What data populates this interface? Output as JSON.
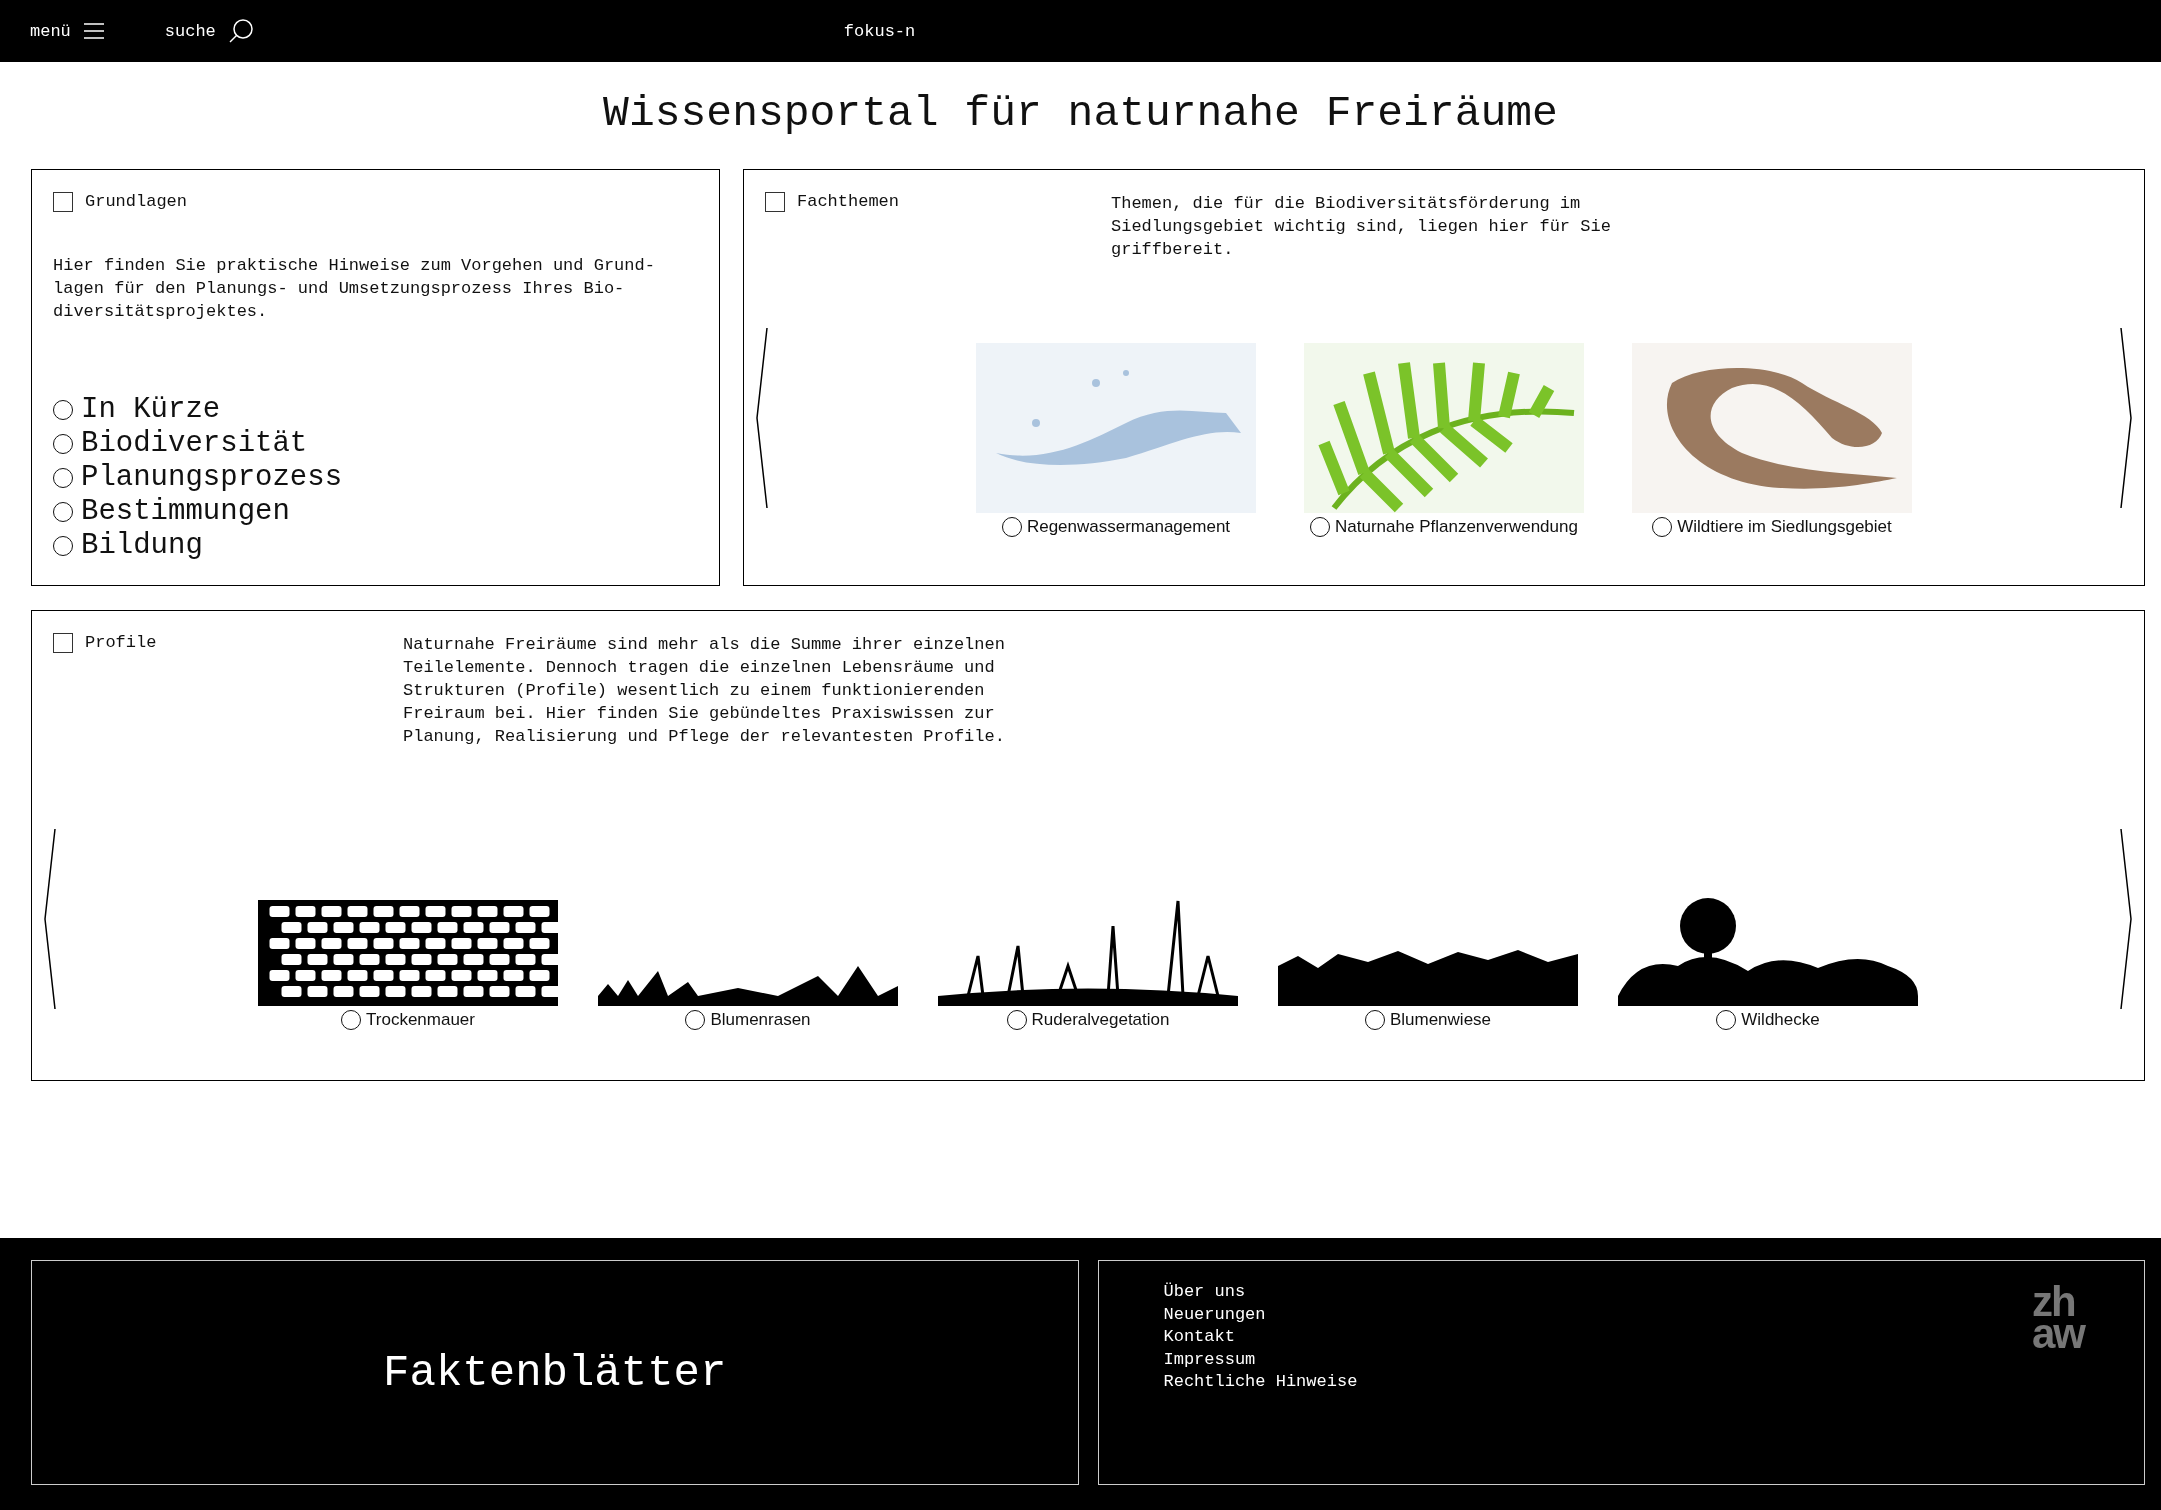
{
  "header": {
    "menu_label": "menü",
    "search_label": "suche",
    "site_name": "fokus-n"
  },
  "title": "Wissensportal für naturnahe Freiräume",
  "grundlagen": {
    "label": "Grundlagen",
    "checked": false,
    "description": "Hier finden Sie praktische Hinweise zum Vorgehen und Grund-\nlagen für den Planungs- und Umsetzungsprozess Ihres Bio-\ndiversitätsprojektes.",
    "options": [
      {
        "label": "In Kürze",
        "selected": false
      },
      {
        "label": "Biodiversität",
        "selected": false
      },
      {
        "label": "Planungsprozess",
        "selected": false
      },
      {
        "label": "Bestimmungen",
        "selected": false
      },
      {
        "label": "Bildung",
        "selected": false
      }
    ]
  },
  "fachthemen": {
    "label": "Fachthemen",
    "checked": false,
    "description": "Themen, die für die Biodiversitätsförderung im\nSiedlungsgebiet wichtig sind, liegen hier für Sie\ngriffbereit.",
    "items": [
      {
        "label": "Regenwassermanagement",
        "kind": "water",
        "selected": false
      },
      {
        "label": "Naturnahe Pflanzenverwendung",
        "kind": "fern",
        "selected": false
      },
      {
        "label": "Wildtiere im Siedlungsgebiet",
        "kind": "lizard",
        "selected": false
      }
    ]
  },
  "profile": {
    "label": "Profile",
    "checked": false,
    "description": "Naturnahe Freiräume sind mehr als die Summe ihrer einzelnen\nTeilelemente. Dennoch tragen die einzelnen Lebensräume und\nStrukturen (Profile) wesentlich zu einem funktionierenden\nFreiraum bei. Hier finden Sie gebündeltes Praxiswissen zur\nPlanung, Realisierung und Pflege der relevantesten Profile.",
    "items": [
      {
        "label": "Trockenmauer",
        "kind": "wall",
        "selected": false
      },
      {
        "label": "Blumenrasen",
        "kind": "lawn",
        "selected": false
      },
      {
        "label": "Ruderalvegetation",
        "kind": "ruderal",
        "selected": false
      },
      {
        "label": "Blumenwiese",
        "kind": "meadow",
        "selected": false
      },
      {
        "label": "Wildhecke",
        "kind": "hedge",
        "selected": false
      }
    ]
  },
  "footer": {
    "factsheets": "Faktenblätter",
    "links": [
      "Über uns",
      "Neuerungen",
      "Kontakt",
      "Impressum",
      "Rechtliche Hinweise"
    ],
    "logo": [
      "zh",
      "aw"
    ]
  }
}
